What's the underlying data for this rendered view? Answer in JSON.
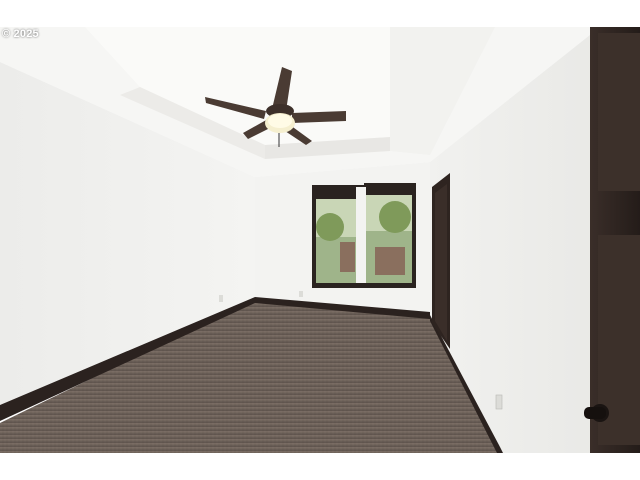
{
  "photo": {
    "copyright_text": "© 2025",
    "subject_icon": "room-interior-photo"
  },
  "colors": {
    "wall": "#f3f3f1",
    "wall_shadow": "#e6e6e3",
    "ceiling": "#f7f7f5",
    "carpet": "#6e625a",
    "baseboard": "#2b221f",
    "door": "#2e2420",
    "fan_blade": "#4a3b33",
    "window_frame": "#2a2320",
    "foliage": "#8aa06a"
  }
}
